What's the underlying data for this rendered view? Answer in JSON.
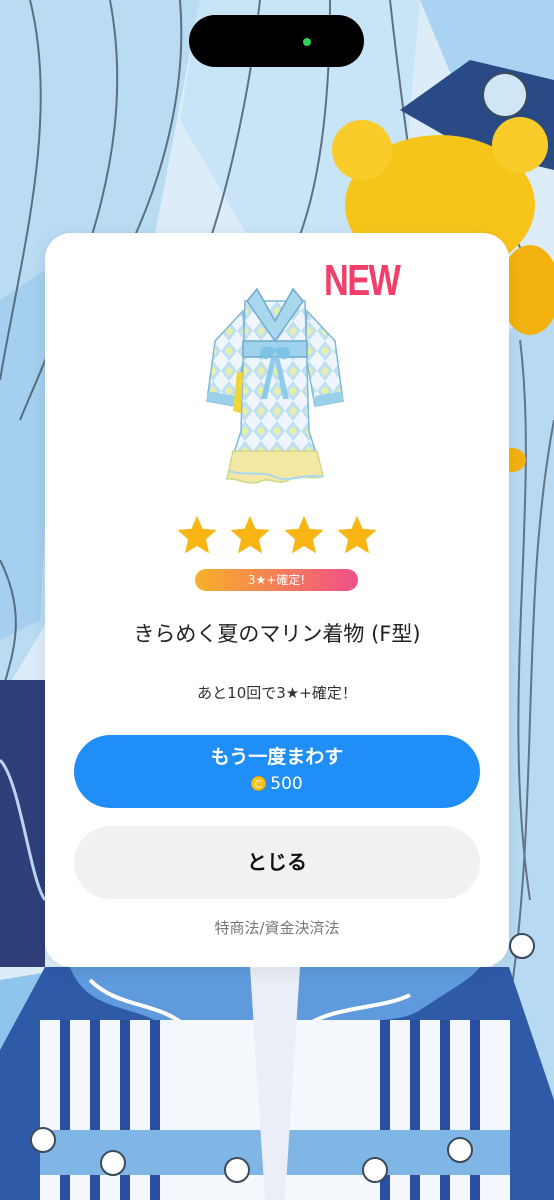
{
  "modal": {
    "new_badge": "NEW",
    "guarantee_pill": "3★+確定!",
    "item_name": "きらめく夏のマリン着物 (F型)",
    "remaining_text": "あと10回で3★+確定！",
    "spin_again_label": "もう一度まわす",
    "spin_cost": "500",
    "close_label": "とじる",
    "legal_link": "特商法/資金決済法",
    "rarity_stars": 4
  },
  "colors": {
    "accent_blue": "#1f8ef6",
    "new_badge": "#f0406a",
    "star": "#f8b514",
    "coin": "#f7c21c"
  },
  "icons": {
    "currency": "coin-icon",
    "rarity": "star-icon"
  }
}
